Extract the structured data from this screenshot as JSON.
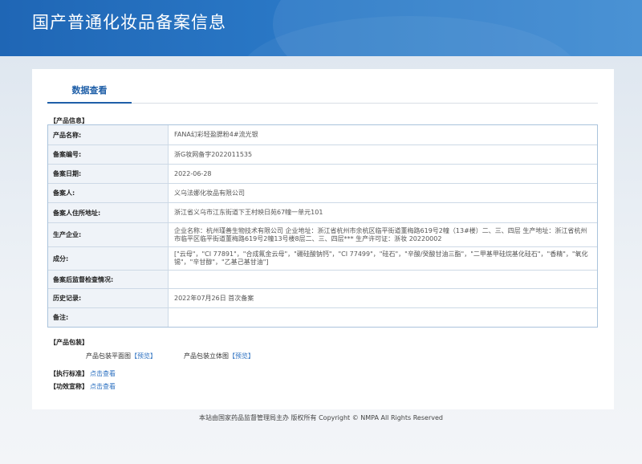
{
  "header": {
    "title": "国产普通化妆品备案信息"
  },
  "tabs": [
    {
      "label": "数据查看"
    }
  ],
  "product_info": {
    "section_title": "【产品信息】",
    "rows": [
      {
        "label": "产品名称:",
        "value": "FANA幻彩轻盈腮粉4#流光银"
      },
      {
        "label": "备案编号:",
        "value": "浙G妆网备字2022011535"
      },
      {
        "label": "备案日期:",
        "value": "2022-06-28"
      },
      {
        "label": "备案人:",
        "value": "义乌法娜化妆品有限公司"
      },
      {
        "label": "备案人住所地址:",
        "value": "浙江省义乌市江东街道下王村映日苑67幢一单元101"
      },
      {
        "label": "生产企业:",
        "value": "企业名称：杭州瑾善生物技术有限公司 企业地址：浙江省杭州市余杭区临平街道董梅路619号2幢（13#楼）二、三、四层 生产地址：浙江省杭州市临平区临平街道董梅路619号2幢13号楼8层二、三、四层*** 生产许可证：浙妆 20220002"
      },
      {
        "label": "成分:",
        "value": "[\"云母\"，\"CI 77891\"，\"合成氟金云母\"，\"硼硅酸钠钙\"，\"CI 77499\"，\"硅石\"，\"辛酸/癸酸甘油三酯\"，\"二甲基甲硅烷基化硅石\"，\"香精\"，\"氧化锡\"，\"辛甘醇\"，\"乙基己基甘油\"]"
      },
      {
        "label": "备案后监督检查情况:",
        "value": ""
      },
      {
        "label": "历史记录:",
        "value": "2022年07月26日 首次备案"
      },
      {
        "label": "备注:",
        "value": ""
      }
    ]
  },
  "packaging": {
    "section_title": "【产品包装】",
    "flat_label": "产品包装平面图",
    "flat_link": "【预览】",
    "solid_label": "产品包装立体图",
    "solid_link": "【预览】"
  },
  "standard": {
    "section_title": "【执行标准】",
    "link": "点击查看"
  },
  "efficacy": {
    "section_title": "【功效宣称】",
    "link": "点击查看"
  },
  "footer": {
    "text": "本站由国家药品监督管理局主办 版权所有 Copyright © NMPA All Rights Reserved"
  }
}
